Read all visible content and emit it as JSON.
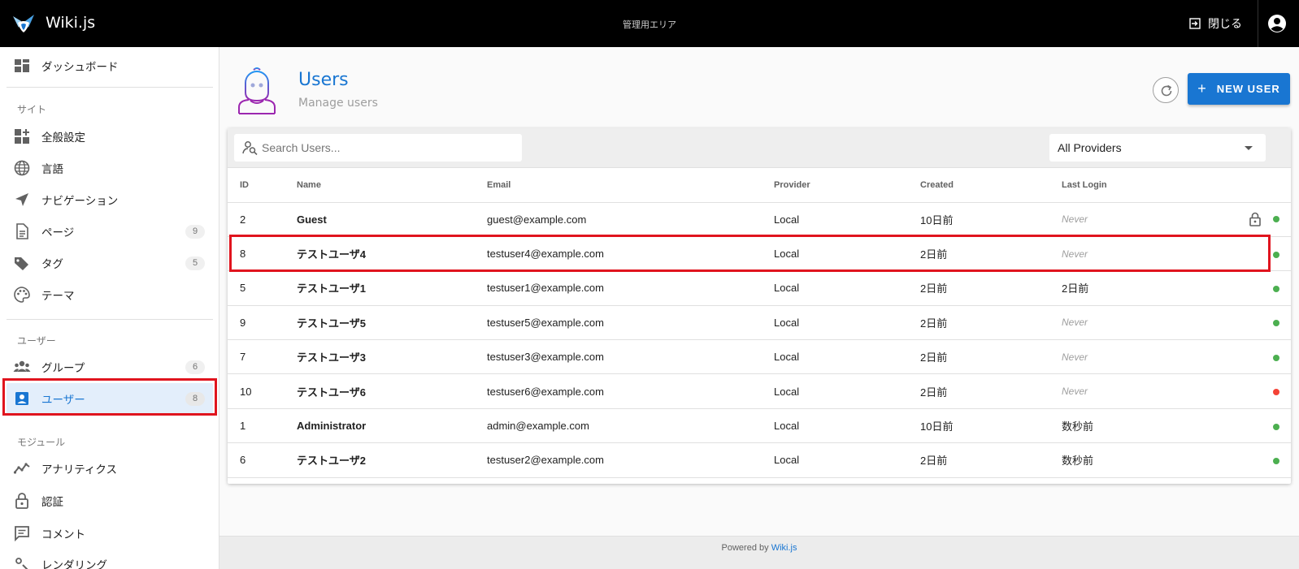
{
  "topbar": {
    "app_title": "Wiki.js",
    "area_label": "管理用エリア",
    "close_label": "閉じる"
  },
  "sidebar": {
    "dashboard": "ダッシュボード",
    "section_site": "サイト",
    "site_items": [
      {
        "label": "全般設定",
        "icon": "dashboard-customize-icon"
      },
      {
        "label": "言語",
        "icon": "globe-icon"
      },
      {
        "label": "ナビゲーション",
        "icon": "navigation-icon"
      },
      {
        "label": "ページ",
        "icon": "page-icon",
        "count": "9"
      },
      {
        "label": "タグ",
        "icon": "tags-icon",
        "count": "5"
      },
      {
        "label": "テーマ",
        "icon": "palette-icon"
      }
    ],
    "section_users": "ユーザー",
    "user_items": [
      {
        "label": "グループ",
        "icon": "groups-icon",
        "count": "6"
      },
      {
        "label": "ユーザー",
        "icon": "account-box-icon",
        "count": "8"
      }
    ],
    "section_modules": "モジュール",
    "module_items": [
      {
        "label": "アナリティクス",
        "icon": "analytics-icon"
      },
      {
        "label": "認証",
        "icon": "lock-icon"
      },
      {
        "label": "コメント",
        "icon": "comment-icon"
      },
      {
        "label": "レンダリング",
        "icon": "rendering-icon"
      }
    ]
  },
  "header": {
    "title": "Users",
    "subtitle": "Manage users",
    "new_user_label": "NEW USER"
  },
  "toolbar": {
    "search_placeholder": "Search Users...",
    "provider_selected": "All Providers"
  },
  "table": {
    "columns": [
      "ID",
      "Name",
      "Email",
      "Provider",
      "Created",
      "Last Login"
    ],
    "rows": [
      {
        "id": "2",
        "name": "Guest",
        "email": "guest@example.com",
        "provider": "Local",
        "created": "10日前",
        "last_login": "Never",
        "never": true,
        "locked": true,
        "status": "active"
      },
      {
        "id": "8",
        "name": "テストユーザ4",
        "email": "testuser4@example.com",
        "provider": "Local",
        "created": "2日前",
        "last_login": "Never",
        "never": true,
        "locked": false,
        "status": "active"
      },
      {
        "id": "5",
        "name": "テストユーザ1",
        "email": "testuser1@example.com",
        "provider": "Local",
        "created": "2日前",
        "last_login": "2日前",
        "never": false,
        "locked": false,
        "status": "active"
      },
      {
        "id": "9",
        "name": "テストユーザ5",
        "email": "testuser5@example.com",
        "provider": "Local",
        "created": "2日前",
        "last_login": "Never",
        "never": true,
        "locked": false,
        "status": "active"
      },
      {
        "id": "7",
        "name": "テストユーザ3",
        "email": "testuser3@example.com",
        "provider": "Local",
        "created": "2日前",
        "last_login": "Never",
        "never": true,
        "locked": false,
        "status": "active"
      },
      {
        "id": "10",
        "name": "テストユーザ6",
        "email": "testuser6@example.com",
        "provider": "Local",
        "created": "2日前",
        "last_login": "Never",
        "never": true,
        "locked": false,
        "status": "inactive"
      },
      {
        "id": "1",
        "name": "Administrator",
        "email": "admin@example.com",
        "provider": "Local",
        "created": "10日前",
        "last_login": "数秒前",
        "never": false,
        "locked": false,
        "status": "active"
      },
      {
        "id": "6",
        "name": "テストユーザ2",
        "email": "testuser2@example.com",
        "provider": "Local",
        "created": "2日前",
        "last_login": "数秒前",
        "never": false,
        "locked": false,
        "status": "active"
      }
    ]
  },
  "footer": {
    "powered_by": "Powered by",
    "link": "Wiki.js"
  },
  "colors": {
    "accent": "#1976d2",
    "active_status": "#4caf50",
    "inactive_status": "#f44336",
    "highlight": "#e0141e"
  }
}
